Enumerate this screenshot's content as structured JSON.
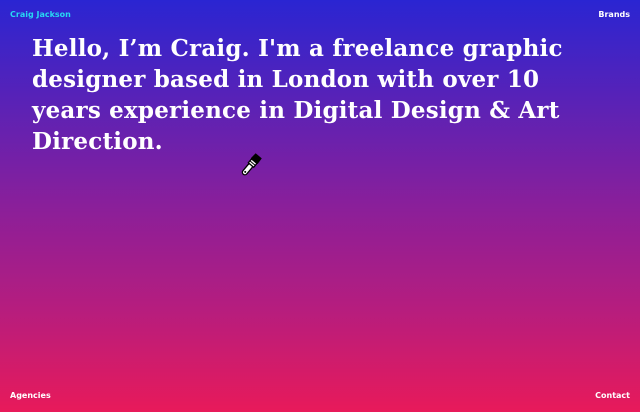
{
  "nav": {
    "home": "Craig Jackson",
    "brands": "Brands",
    "agencies": "Agencies",
    "contact": "Contact"
  },
  "hero": {
    "text": "Hello, I’m Craig. I'm a freelance graphic designer based in London with over 10 years experience in Digital Design & Art Direction."
  },
  "icons": {
    "cursor": "paintbrush-icon"
  },
  "colors": {
    "gradient_top": "#2a25d2",
    "gradient_bottom": "#e81a5a",
    "accent": "#27d7f2",
    "text": "#ffffff"
  }
}
